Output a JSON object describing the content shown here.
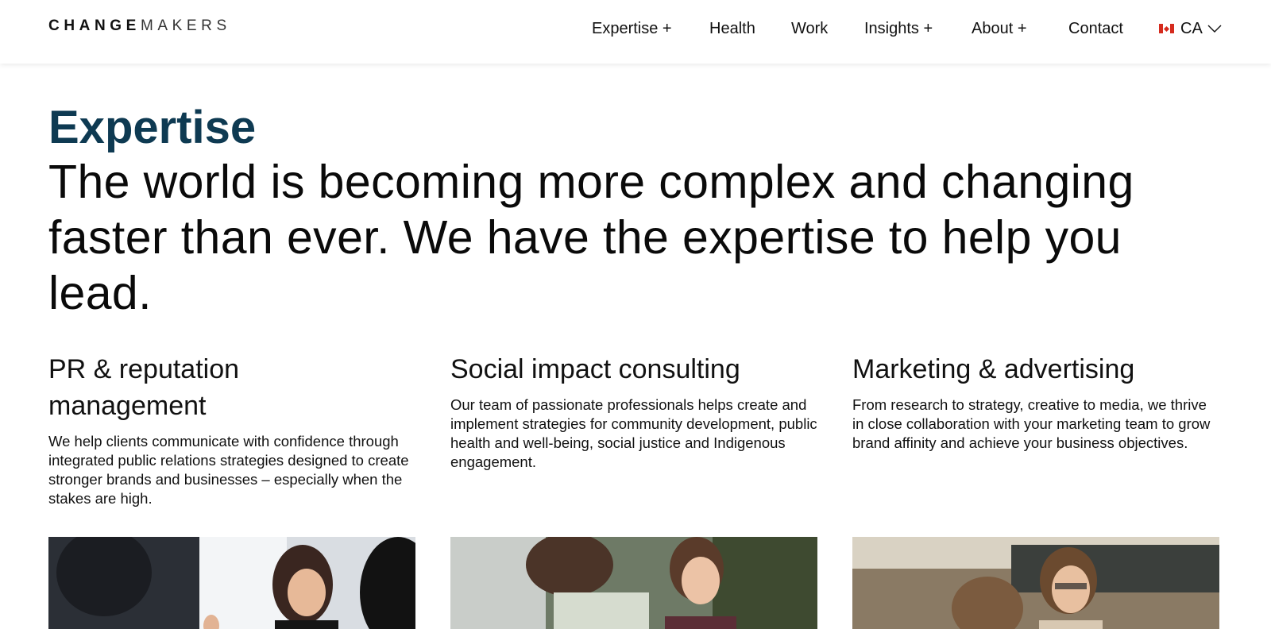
{
  "brand": {
    "logo_bold": "CHANGE",
    "logo_light": "MAKERS"
  },
  "nav": {
    "items": [
      "Expertise +",
      "Health",
      "Work",
      "Insights +",
      "About +",
      "Contact"
    ],
    "locale": "CA",
    "flag_icon": "canada-flag-icon"
  },
  "hero": {
    "kicker": "Expertise",
    "headline": "The world is becoming more complex and changing faster than ever. We have the expertise to help you lead."
  },
  "services": [
    {
      "title": "PR & reputation management",
      "body": "We help clients communicate with confidence through integrated public relations strategies designed to create stronger brands and businesses – especially when the stakes are high."
    },
    {
      "title": "Social impact consulting",
      "body": "Our team of passionate professionals helps create and implement strategies for community development, public health and well-being, social justice and Indigenous engagement."
    },
    {
      "title": "Marketing & advertising",
      "body": "From research to strategy, creative to media, we thrive in close collaboration with your marketing team to grow brand affinity and achieve your business objectives."
    }
  ],
  "colors": {
    "accent": "#0e3a52",
    "text": "#111111",
    "flag_red": "#d52b1e"
  }
}
